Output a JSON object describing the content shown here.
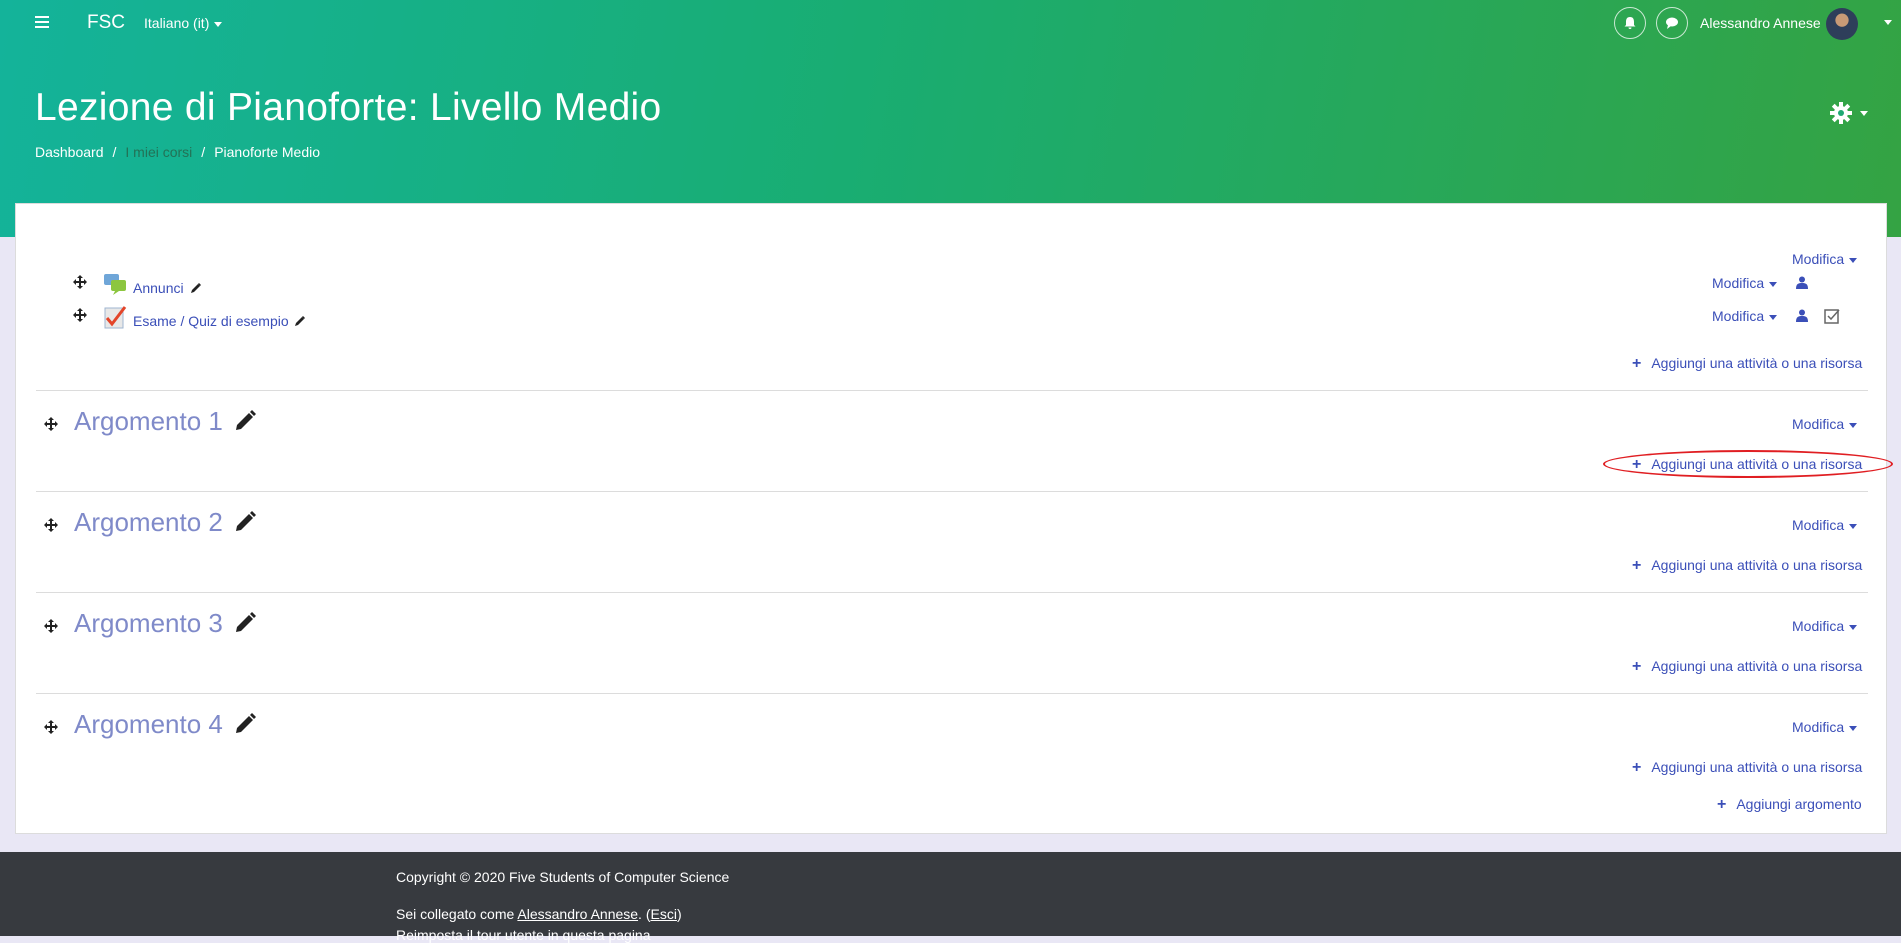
{
  "nav": {
    "brand": "FSC",
    "language": "Italiano (it)",
    "username": "Alessandro Annese"
  },
  "header": {
    "title": "Lezione di Pianoforte: Livello Medio",
    "breadcrumb": [
      "Dashboard",
      "I miei corsi",
      "Pianoforte Medio"
    ]
  },
  "course": {
    "edit_label": "Modifica",
    "add_activity_label": "Aggiungi una attività o una risorsa",
    "add_section_label": "Aggiungi argomento",
    "activities": [
      {
        "name": "Annunci",
        "icon": "forum-icon"
      },
      {
        "name": "Esame / Quiz di esempio",
        "icon": "quiz-icon"
      }
    ],
    "sections": [
      {
        "title": "Argomento 1"
      },
      {
        "title": "Argomento 2"
      },
      {
        "title": "Argomento 3"
      },
      {
        "title": "Argomento 4"
      }
    ]
  },
  "footer": {
    "copyright": "Copyright © 2020 Five Students of Computer Science",
    "logged_prefix": "Sei collegato come ",
    "logged_user": "Alessandro Annese",
    "logout_open": ". (",
    "logout_label": "Esci",
    "logout_close": ")",
    "tour_label": "Reimposta il tour utente in questa pagina"
  },
  "colors": {
    "header_start": "#14b39a",
    "header_end": "#34a343",
    "link": "#3b4fb8",
    "footer_bg": "#373a3f",
    "annotation": "#e01e22"
  }
}
